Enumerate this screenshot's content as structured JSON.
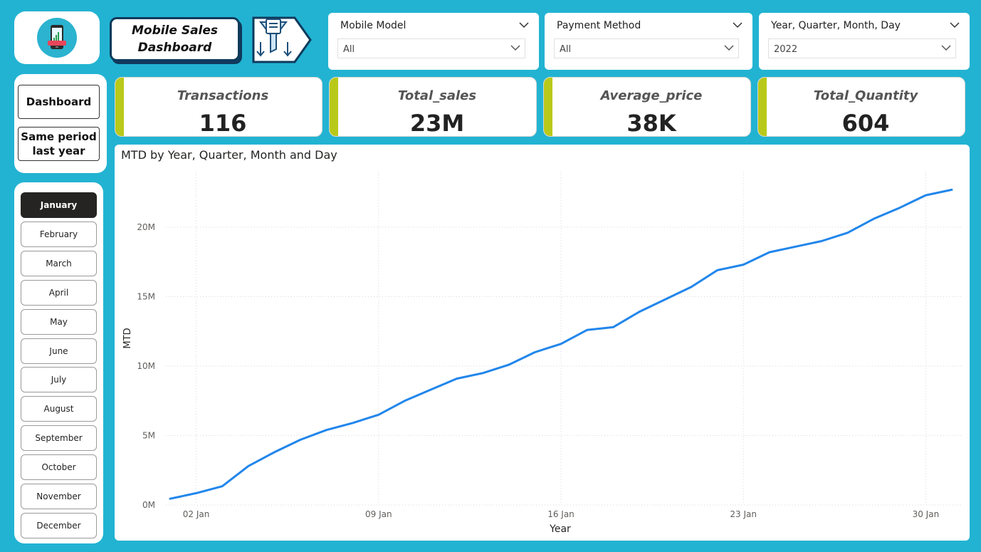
{
  "header": {
    "title": "Mobile Sales Dashboard",
    "logo_icon": "mobile-sales-icon",
    "filter_icon": "filter-funnel-icon"
  },
  "slicers": [
    {
      "title": "Mobile Model",
      "value": "All"
    },
    {
      "title": "Payment Method",
      "value": "All"
    },
    {
      "title": "Year, Quarter, Month, Day",
      "value": "2022"
    }
  ],
  "nav": {
    "dashboard": "Dashboard",
    "same_period": "Same period last year"
  },
  "months": [
    "January",
    "February",
    "March",
    "April",
    "May",
    "June",
    "July",
    "August",
    "September",
    "October",
    "November",
    "December"
  ],
  "selected_month": "January",
  "kpis": [
    {
      "label": "Transactions",
      "value": "116"
    },
    {
      "label": "Total_sales",
      "value": "23M"
    },
    {
      "label": "Average_price",
      "value": "38K"
    },
    {
      "label": "Total_Quantity",
      "value": "604"
    }
  ],
  "colors": {
    "background": "#22b3d2",
    "kpi_accent": "#b9c91a",
    "line": "#2186eb",
    "active_month": "#252423"
  },
  "chart_data": {
    "type": "line",
    "title": "MTD by Year, Quarter, Month and Day",
    "xlabel": "Year",
    "ylabel": "MTD",
    "x_ticks": [
      "02 Jan",
      "09 Jan",
      "16 Jan",
      "23 Jan",
      "30 Jan"
    ],
    "y_ticks": [
      "0M",
      "5M",
      "10M",
      "15M",
      "20M"
    ],
    "ylim": [
      0,
      24000000
    ],
    "grid": true,
    "x": [
      "01 Jan",
      "02 Jan",
      "03 Jan",
      "04 Jan",
      "05 Jan",
      "06 Jan",
      "07 Jan",
      "08 Jan",
      "09 Jan",
      "10 Jan",
      "11 Jan",
      "12 Jan",
      "13 Jan",
      "14 Jan",
      "15 Jan",
      "16 Jan",
      "17 Jan",
      "18 Jan",
      "19 Jan",
      "20 Jan",
      "21 Jan",
      "22 Jan",
      "23 Jan",
      "24 Jan",
      "25 Jan",
      "26 Jan",
      "27 Jan",
      "28 Jan",
      "29 Jan",
      "30 Jan",
      "31 Jan"
    ],
    "series": [
      {
        "values": [
          450000,
          850000,
          1350000,
          2800000,
          3800000,
          4700000,
          5400000,
          5900000,
          6500000,
          7500000,
          8300000,
          9100000,
          9500000,
          10100000,
          11000000,
          11600000,
          12600000,
          12800000,
          13900000,
          14800000,
          15700000,
          16900000,
          17300000,
          18200000,
          18600000,
          19000000,
          19600000,
          20600000,
          21400000,
          22300000,
          22700000
        ]
      }
    ]
  }
}
